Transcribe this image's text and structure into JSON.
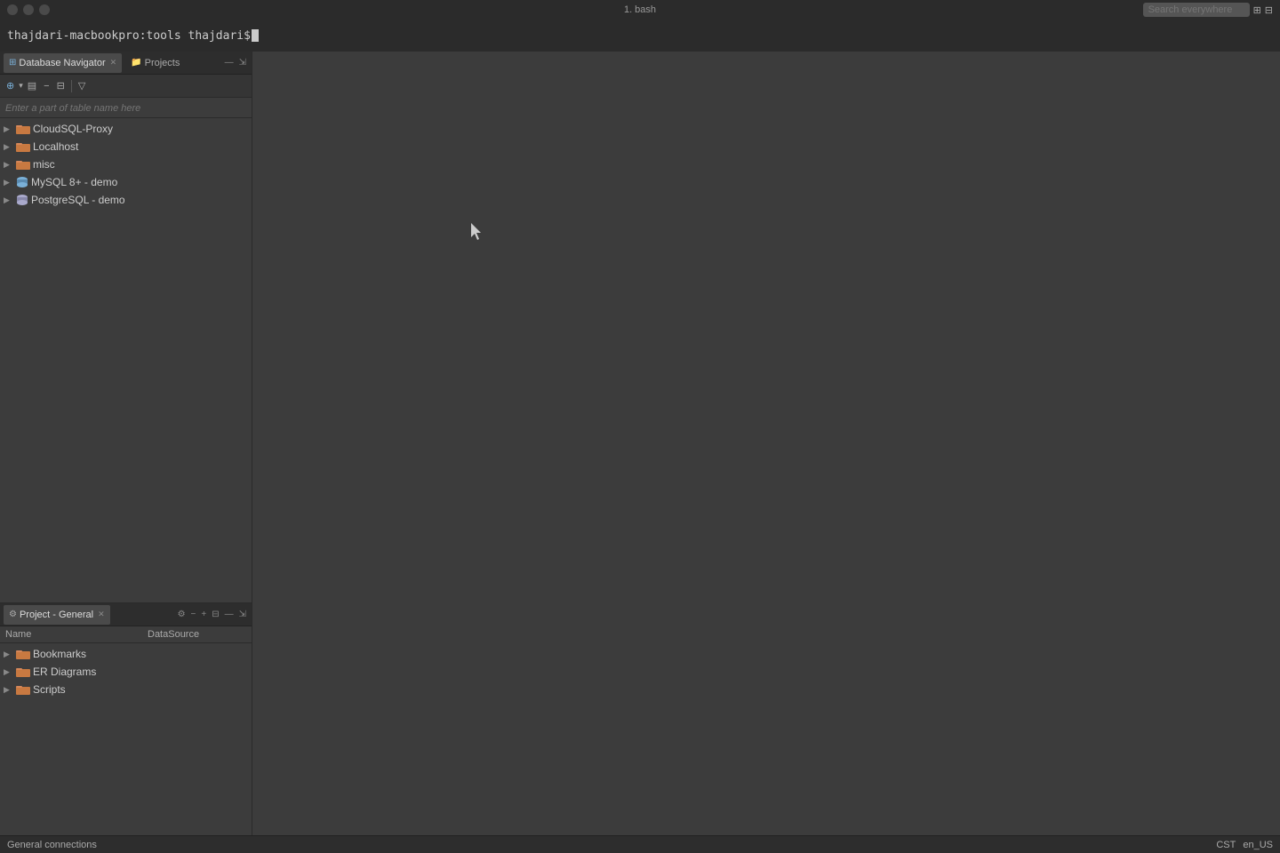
{
  "titleBar": {
    "title": "1. bash",
    "searchPlaceholder": "Search everywhere"
  },
  "terminal": {
    "prompt": "thajdari-macbookpro:tools thajdari$ "
  },
  "topPanel": {
    "tabs": [
      {
        "id": "database-navigator",
        "label": "Database Navigator",
        "icon": "db",
        "active": true,
        "closable": true
      },
      {
        "id": "projects",
        "label": "Projects",
        "icon": "folder",
        "active": false,
        "closable": false
      }
    ],
    "searchPlaceholder": "Enter a part of table name here",
    "treeItems": [
      {
        "id": "cloud-sql",
        "label": "CloudSQL-Proxy",
        "indent": 0,
        "expanded": false,
        "folderColor": "orange"
      },
      {
        "id": "localhost",
        "label": "Localhost",
        "indent": 0,
        "expanded": false,
        "folderColor": "orange"
      },
      {
        "id": "misc",
        "label": "misc",
        "indent": 0,
        "expanded": false,
        "folderColor": "orange"
      },
      {
        "id": "mysql",
        "label": "MySQL 8+ - demo",
        "indent": 0,
        "expanded": false,
        "folderColor": "blue",
        "dbType": "mysql"
      },
      {
        "id": "postgresql",
        "label": "PostgreSQL - demo",
        "indent": 0,
        "expanded": false,
        "folderColor": "blue",
        "dbType": "pg"
      }
    ]
  },
  "bottomPanel": {
    "tabs": [
      {
        "id": "project-general",
        "label": "Project - General",
        "icon": "gear",
        "active": true,
        "closable": true
      }
    ],
    "columns": [
      {
        "id": "name",
        "label": "Name"
      },
      {
        "id": "datasource",
        "label": "DataSource"
      }
    ],
    "treeItems": [
      {
        "id": "bookmarks",
        "label": "Bookmarks",
        "indent": 0,
        "expanded": false,
        "folderColor": "orange"
      },
      {
        "id": "er-diagrams",
        "label": "ER Diagrams",
        "indent": 0,
        "expanded": false,
        "folderColor": "orange"
      },
      {
        "id": "scripts",
        "label": "Scripts",
        "indent": 0,
        "expanded": false,
        "folderColor": "orange"
      }
    ]
  },
  "statusBar": {
    "leftText": "General connections",
    "cst": "CST",
    "locale": "en_US"
  },
  "icons": {
    "close": "✕",
    "chevronRight": "▶",
    "chevronDown": "▼",
    "gear": "⚙",
    "plus": "+",
    "minus": "−",
    "refresh": "↻",
    "filter": "≡",
    "collapse": "⇱",
    "expand": "⇲",
    "folder": "📁",
    "window": "⧉"
  }
}
